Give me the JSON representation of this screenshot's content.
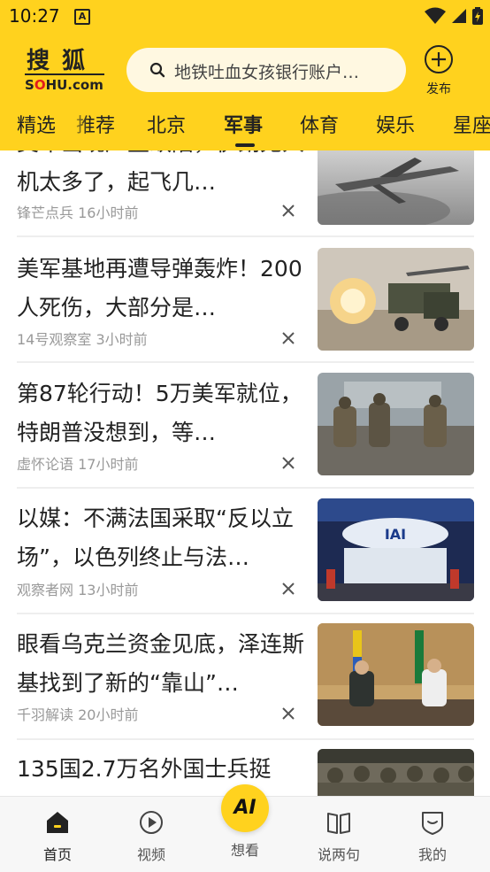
{
  "status_bar": {
    "time": "10:27",
    "notif_glyph": "A"
  },
  "header": {
    "logo_cn": "搜狐",
    "logo_en_prefix": "S",
    "logo_en_o": "O",
    "logo_en_suffix": "HU.com",
    "search_placeholder": "地铁吐血女孩银行账户…",
    "publish_label": "发布"
  },
  "tabs": [
    "精选",
    "推荐",
    "北京",
    "军事",
    "体育",
    "娱乐",
    "星座"
  ],
  "active_tab": "军事",
  "feed": [
    {
      "title": "美军出现严重缺陷，伊朗无人机太多了，起飞几…",
      "source": "锋芒点兵",
      "time": "16小时前",
      "thumb": "drone"
    },
    {
      "title": "美军基地再遭导弹轰炸！200人死伤，大部分是…",
      "source": "14号观察室",
      "time": "3小时前",
      "thumb": "missile"
    },
    {
      "title": "第87轮行动！5万美军就位，特朗普没想到，等…",
      "source": "虚怀论语",
      "time": "17小时前",
      "thumb": "soldiers"
    },
    {
      "title": "以媒：不满法国采取“反以立场”，以色列终止与法…",
      "source": "观察者网",
      "time": "13小时前",
      "thumb": "expo"
    },
    {
      "title": "眼看乌克兰资金见底，泽连斯基找到了新的“靠山”…",
      "source": "千羽解读",
      "time": "20小时前",
      "thumb": "meeting"
    },
    {
      "title": "135国2.7万名外国士兵挺",
      "source": "",
      "time": "",
      "thumb": "troops"
    }
  ],
  "bottom_nav": [
    {
      "label": "首页",
      "icon": "home-icon"
    },
    {
      "label": "视频",
      "icon": "play-icon"
    },
    {
      "label": "想看",
      "icon": "ai-icon"
    },
    {
      "label": "说两句",
      "icon": "book-icon"
    },
    {
      "label": "我的",
      "icon": "shield-icon"
    }
  ],
  "ai_button_text": "AI",
  "colors": {
    "brand": "#FFD21E",
    "text": "#222222",
    "meta": "#999999"
  }
}
